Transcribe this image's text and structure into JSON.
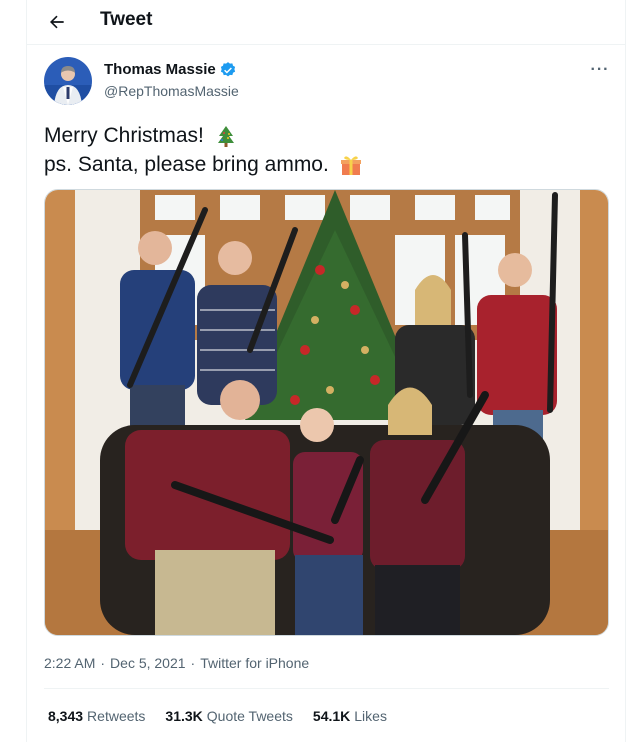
{
  "header": {
    "title": "Tweet",
    "back_icon": "arrow-left-icon"
  },
  "author": {
    "name": "Thomas Massie",
    "handle": "@RepThomasMassie",
    "verified_icon": "verified-badge-icon",
    "verified_color": "#1d9bf0"
  },
  "more_icon": "more-options-icon",
  "tweet": {
    "line1": "Merry Christmas!",
    "line1_emoji": "christmas-tree-icon",
    "line2": "ps. Santa, please bring ammo.",
    "line2_emoji": "wrapped-gift-icon"
  },
  "photo": {
    "description_icon": "photo"
  },
  "meta": {
    "time": "2:22 AM",
    "sep1": "·",
    "date": "Dec 5, 2021",
    "sep2": "·",
    "source": "Twitter for iPhone"
  },
  "stats": {
    "retweets_count": "8,343",
    "retweets_label": "Retweets",
    "quotes_count": "31.3K",
    "quotes_label": "Quote Tweets",
    "likes_count": "54.1K",
    "likes_label": "Likes"
  },
  "colors": {
    "text": "#0f1419",
    "secondary": "#536471",
    "border": "#eff3f4",
    "accent": "#1d9bf0"
  }
}
